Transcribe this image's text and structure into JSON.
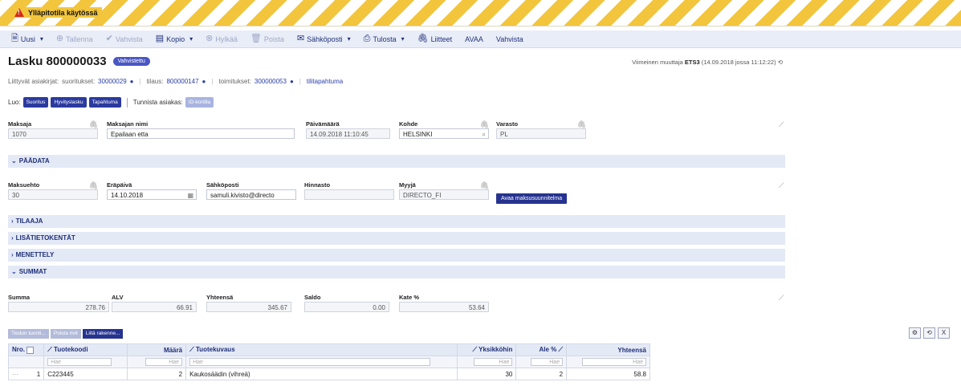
{
  "banner": {
    "label": "Ylläpitotila käytössä",
    "color": "#f2c53d"
  },
  "toolbar": [
    {
      "label": "Uusi",
      "icon": "new-doc-icon",
      "caret": true,
      "disabled": false
    },
    {
      "label": "Tallenna",
      "icon": "save-icon",
      "caret": false,
      "disabled": true
    },
    {
      "label": "Vahvista",
      "icon": "check-icon",
      "caret": false,
      "disabled": true
    },
    {
      "label": "Kopio",
      "icon": "copy-icon",
      "caret": true,
      "disabled": false
    },
    {
      "label": "Hylkää",
      "icon": "reject-icon",
      "caret": false,
      "disabled": true
    },
    {
      "label": "Poista",
      "icon": "trash-icon",
      "caret": false,
      "disabled": true
    },
    {
      "label": "Sähköposti",
      "icon": "mail-icon",
      "caret": true,
      "disabled": false
    },
    {
      "label": "Tulosta",
      "icon": "print-icon",
      "caret": true,
      "disabled": false
    },
    {
      "label": "Liitteet",
      "icon": "attachment-icon",
      "caret": false,
      "disabled": false
    },
    {
      "label": "AVAA",
      "icon": "",
      "caret": false,
      "disabled": false
    },
    {
      "label": "Vahvista",
      "icon": "",
      "caret": false,
      "disabled": false
    }
  ],
  "header": {
    "title": "Lasku 800000033",
    "status": "Vahvistettu",
    "modified_prefix": "Viimeinen muuttaja",
    "modified_user": "ETS3",
    "modified_time": "(14.09.2018 jossa 11:12:22)"
  },
  "related": {
    "prefix": "Liittyvät asiakirjat:",
    "suoritukset_label": "suoritukset:",
    "suoritukset_value": "30000029",
    "tilaus_label": "tilaus:",
    "tilaus_value": "800000147",
    "toimitukset_label": "toimitukset:",
    "toimitukset_value": "300000053",
    "tilitapahtuma": "tilitapahtuma"
  },
  "luo": {
    "label": "Luo:",
    "buttons": [
      "Suoritus",
      "Hyvityslasku",
      "Tapahtuma"
    ],
    "identify_label": "Tunnista asiakas:",
    "identify_button": "ID-kortilla"
  },
  "top_fields": {
    "maksaja": {
      "label": "Maksaja",
      "value": "1070"
    },
    "maksajan_nimi": {
      "label": "Maksajan nimi",
      "value": "Epailaan etta"
    },
    "paivamaara": {
      "label": "Päivämäärä",
      "value": "14.09.2018 11:10:45"
    },
    "kohde": {
      "label": "Kohde",
      "value": "HELSINKI"
    },
    "varasto": {
      "label": "Varasto",
      "value": "PL"
    }
  },
  "sections": {
    "paadata": "PÄÄDATA",
    "tilaaja": "TILAAJA",
    "lisatietokentat": "LISÄTIETOKENTÄT",
    "menettely": "MENETTELY",
    "summat": "SUMMAT"
  },
  "paadata_fields": {
    "maksuehto": {
      "label": "Maksuehto",
      "value": "30"
    },
    "erapaiva": {
      "label": "Eräpäivä",
      "value": "14.10.2018"
    },
    "sahkoposti": {
      "label": "Sähköposti",
      "value": "samuli.kivisto@directo"
    },
    "hinnasto": {
      "label": "Hinnasto",
      "value": ""
    },
    "myyja": {
      "label": "Myyjä",
      "value": "DIRECTO_FI"
    },
    "plan_button": "Avaa maksusuunnitelma"
  },
  "summat_fields": {
    "summa": {
      "label": "Summa",
      "value": "278.76"
    },
    "alv": {
      "label": "ALV",
      "value": "66.91"
    },
    "yhteensa": {
      "label": "Yhteensä",
      "value": "345.67"
    },
    "saldo": {
      "label": "Saldo",
      "value": "0.00"
    },
    "kate": {
      "label": "Kate %",
      "value": "53.64"
    }
  },
  "grid": {
    "buttons": [
      "Tiedon tuonti...",
      "Poista rivit",
      "Liitä rakenne..."
    ],
    "headers": {
      "nro": "Nro.",
      "tuotekoodi": "Tuotekoodi",
      "maara": "Määrä",
      "tuotekuvaus": "Tuotekuvaus",
      "yksikkohinta": "Yksikköhin",
      "ale": "Ale %",
      "yhteensa": "Yhteensä"
    },
    "filter_placeholder": "Hae",
    "rows": [
      {
        "nro": "1",
        "tuotekoodi": "C223445",
        "maara": "2",
        "tuotekuvaus": "Kaukosäädin (vihreä)",
        "yksikkohinta": "30",
        "ale": "2",
        "yhteensa": "58.8"
      }
    ]
  }
}
